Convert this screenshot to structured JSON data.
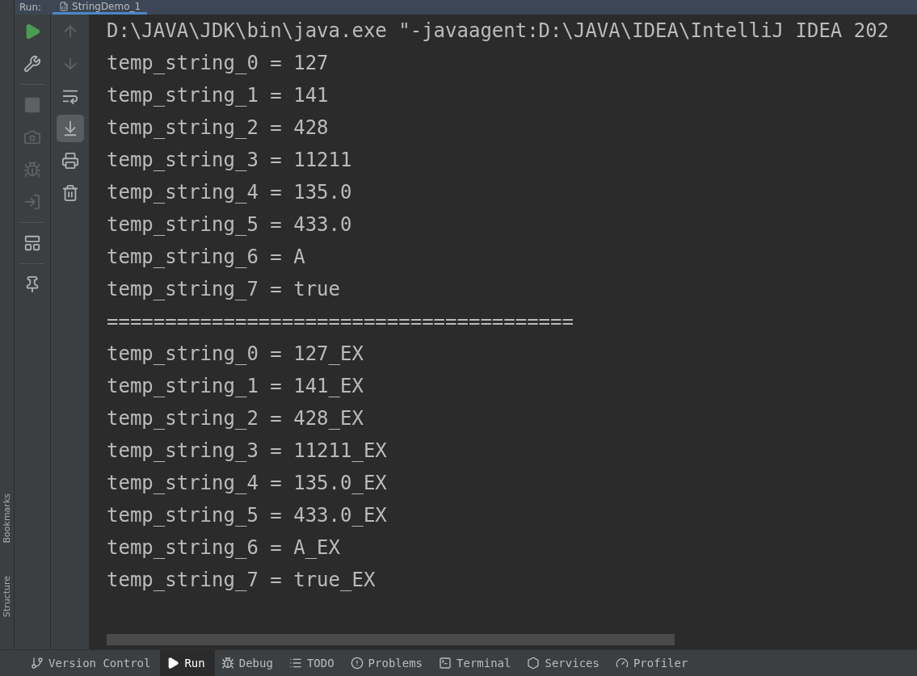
{
  "run_panel": {
    "label": "Run:",
    "tab": {
      "title": "StringDemo_1",
      "selected": true
    }
  },
  "left_toolbar": [
    {
      "kind": "run",
      "disabled": false
    },
    {
      "kind": "settings",
      "disabled": false
    },
    {
      "kind": "separator"
    },
    {
      "kind": "stop",
      "disabled": true
    },
    {
      "kind": "camera",
      "disabled": true
    },
    {
      "kind": "bug",
      "disabled": true
    },
    {
      "kind": "enter",
      "disabled": true
    },
    {
      "kind": "separator"
    },
    {
      "kind": "layout",
      "disabled": false
    },
    {
      "kind": "separator"
    },
    {
      "kind": "pin",
      "disabled": false
    }
  ],
  "console_toolbar": [
    {
      "kind": "up",
      "disabled": true,
      "selected": false
    },
    {
      "kind": "down",
      "disabled": true,
      "selected": false
    },
    {
      "kind": "wrap",
      "disabled": false,
      "selected": false
    },
    {
      "kind": "scroll-end",
      "disabled": false,
      "selected": true
    },
    {
      "kind": "print",
      "disabled": false,
      "selected": false
    },
    {
      "kind": "trash",
      "disabled": false,
      "selected": false
    }
  ],
  "side_labels": [
    "Bookmarks",
    "Structure"
  ],
  "console_lines": [
    "D:\\JAVA\\JDK\\bin\\java.exe \"-javaagent:D:\\JAVA\\IDEA\\IntelliJ IDEA 202",
    "temp_string_0 = 127",
    "temp_string_1 = 141",
    "temp_string_2 = 428",
    "temp_string_3 = 11211",
    "temp_string_4 = 135.0",
    "temp_string_5 = 433.0",
    "temp_string_6 = A",
    "temp_string_7 = true",
    "========================================",
    "temp_string_0 = 127_EX",
    "temp_string_1 = 141_EX",
    "temp_string_2 = 428_EX",
    "temp_string_3 = 11211_EX",
    "temp_string_4 = 135.0_EX",
    "temp_string_5 = 433.0_EX",
    "temp_string_6 = A_EX",
    "temp_string_7 = true_EX"
  ],
  "bottom_tabs": [
    {
      "kind": "vcs",
      "label": "Version Control",
      "selected": false
    },
    {
      "kind": "run",
      "label": "Run",
      "selected": true
    },
    {
      "kind": "debug",
      "label": "Debug",
      "selected": false
    },
    {
      "kind": "todo",
      "label": "TODO",
      "selected": false
    },
    {
      "kind": "problems",
      "label": "Problems",
      "selected": false
    },
    {
      "kind": "terminal",
      "label": "Terminal",
      "selected": false
    },
    {
      "kind": "services",
      "label": "Services",
      "selected": false
    },
    {
      "kind": "profiler",
      "label": "Profiler",
      "selected": false
    }
  ]
}
